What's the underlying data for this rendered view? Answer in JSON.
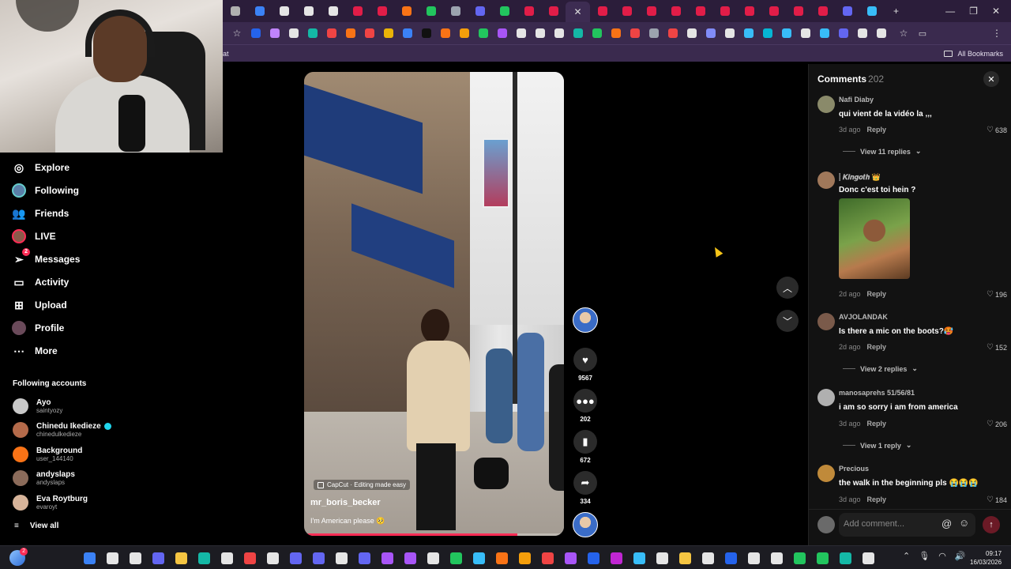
{
  "browser": {
    "tab_colors": [
      "#b0b0b0",
      "#3b82f6",
      "#e5e5e5",
      "#e5e5e5",
      "#e5e5e5",
      "#e11d48",
      "#e11d48",
      "#f97316",
      "#22c55e",
      "#9ca3af",
      "#6366f1",
      "#22c55e",
      "#e11d48",
      "#e11d48",
      "#ffffff",
      "#e11d48",
      "#e11d48",
      "#e11d48",
      "#e11d48",
      "#e11d48",
      "#e11d48",
      "#e11d48",
      "#e11d48",
      "#e11d48",
      "#e11d48",
      "#6366f1",
      "#38bdf8"
    ],
    "ext_colors": [
      "#2563eb",
      "#c084fc",
      "#e5e5e5",
      "#14b8a6",
      "#ef4444",
      "#f97316",
      "#ef4444",
      "#eab308",
      "#3b82f6",
      "#111111",
      "#f97316",
      "#f59e0b",
      "#22c55e",
      "#a855f7",
      "#e5e5e5",
      "#e5e5e5",
      "#e5e5e5",
      "#14b8a6",
      "#22c55e",
      "#f97316",
      "#ef4444",
      "#9ca3af",
      "#ef4444",
      "#e5e5e5",
      "#818cf8",
      "#e5e5e5",
      "#38bdf8",
      "#06b6d4",
      "#38bdf8",
      "#e5e5e5",
      "#38bdf8",
      "#6366f1",
      "#e5e5e5",
      "#e5e5e5"
    ],
    "bookmark_fragment": "at",
    "all_bookmarks": "All Bookmarks"
  },
  "nav": {
    "items": [
      {
        "label": "Explore",
        "icon": "compass-icon"
      },
      {
        "label": "Following",
        "icon": "following-avatar-icon"
      },
      {
        "label": "Friends",
        "icon": "friends-icon"
      },
      {
        "label": "LIVE",
        "icon": "live-avatar-icon"
      },
      {
        "label": "Messages",
        "icon": "messages-icon",
        "badge": "2"
      },
      {
        "label": "Activity",
        "icon": "activity-icon"
      },
      {
        "label": "Upload",
        "icon": "upload-icon"
      },
      {
        "label": "Profile",
        "icon": "profile-avatar-icon"
      },
      {
        "label": "More",
        "icon": "more-icon"
      }
    ],
    "following_title": "Following accounts",
    "accounts": [
      {
        "name": "Ayo",
        "handle": "saintyozy",
        "color": "#c9c9c9",
        "verified": false
      },
      {
        "name": "Chinedu Ikedieze",
        "handle": "chinedulkedieze",
        "color": "#b46a4a",
        "verified": true
      },
      {
        "name": "Background",
        "handle": "user_144140",
        "color": "#f97316",
        "verified": false
      },
      {
        "name": "andyslaps",
        "handle": "andyslaps",
        "color": "#8b6b5a",
        "verified": false
      },
      {
        "name": "Eva Roytburg",
        "handle": "evaroyt",
        "color": "#d7b49a",
        "verified": false
      }
    ],
    "view_all": "View all"
  },
  "video": {
    "capcut": "CapCut · Editing made easy",
    "author": "mr_boris_becker",
    "caption": "I'm American please 🥺",
    "progress": 0.82,
    "likes": "9567",
    "comments": "202",
    "saves": "672",
    "shares": "334"
  },
  "comments": {
    "title": "Comments",
    "count": "202",
    "items": [
      {
        "user": "Nafi Diaby",
        "text": "qui vient de la vidéo la ,,,",
        "age": "3d ago",
        "reply": "Reply",
        "likes": "638",
        "replies": "View 11 replies",
        "avatar": "#8a8a6a"
      },
      {
        "user": "⸽ 𝑲𝒊𝒏𝒈𝒐𝒕𝒉 👑",
        "text": "Donc c'est toi hein ?",
        "age": "2d ago",
        "reply": "Reply",
        "likes": "196",
        "avatar": "#a0785a"
      },
      {
        "user": "AVJOLANDAK",
        "text": "Is there a mic on the boots?🥵",
        "age": "2d ago",
        "reply": "Reply",
        "likes": "152",
        "replies": "View 2 replies",
        "avatar": "#7a5a4a"
      },
      {
        "user": "manosaprehs 51/56/81",
        "text": "i am so sorry i am from america",
        "age": "3d ago",
        "reply": "Reply",
        "likes": "206",
        "replies": "View 1 reply",
        "avatar": "#b0b0b0"
      },
      {
        "user": "Precious",
        "text": "the walk in the beginning pls 😭😭😭",
        "age": "3d ago",
        "reply": "Reply",
        "likes": "184",
        "avatar": "#c08a3a"
      }
    ],
    "placeholder": "Add comment..."
  },
  "taskbar": {
    "badge": "2",
    "app_colors": [
      "#3b82f6",
      "#e5e5e5",
      "#e5e5e5",
      "#6366f1",
      "#f5c542",
      "#14b8a6",
      "#e5e5e5",
      "#ef4444",
      "#e5e5e5",
      "#6366f1",
      "#6366f1",
      "#e5e5e5",
      "#6366f1",
      "#a855f7",
      "#a855f7",
      "#e5e5e5",
      "#22c55e",
      "#38bdf8",
      "#f97316",
      "#f59e0b",
      "#ef4444",
      "#a855f7",
      "#2563eb",
      "#c026d3",
      "#38bdf8",
      "#e5e5e5",
      "#f5c542",
      "#e5e5e5",
      "#2563eb",
      "#e5e5e5",
      "#e5e5e5",
      "#22c55e",
      "#22c55e",
      "#14b8a6",
      "#e5e5e5"
    ],
    "time": "09:17",
    "date": "16/03/2026"
  }
}
